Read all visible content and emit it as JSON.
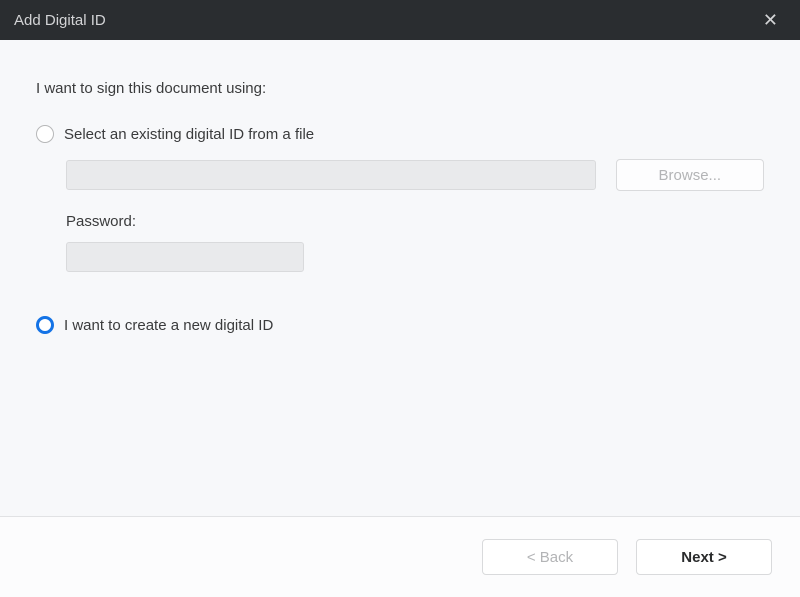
{
  "titlebar": {
    "title": "Add Digital ID",
    "close_icon": "✕"
  },
  "heading": "I want to sign this document using:",
  "option_existing": {
    "label": "Select an existing digital ID from a file",
    "selected": false,
    "file_value": "",
    "browse_label": "Browse...",
    "password_label": "Password:",
    "password_value": ""
  },
  "option_create": {
    "label": "I want to create a new digital ID",
    "selected": true
  },
  "footer": {
    "back_label": "< Back",
    "next_label": "Next >"
  }
}
